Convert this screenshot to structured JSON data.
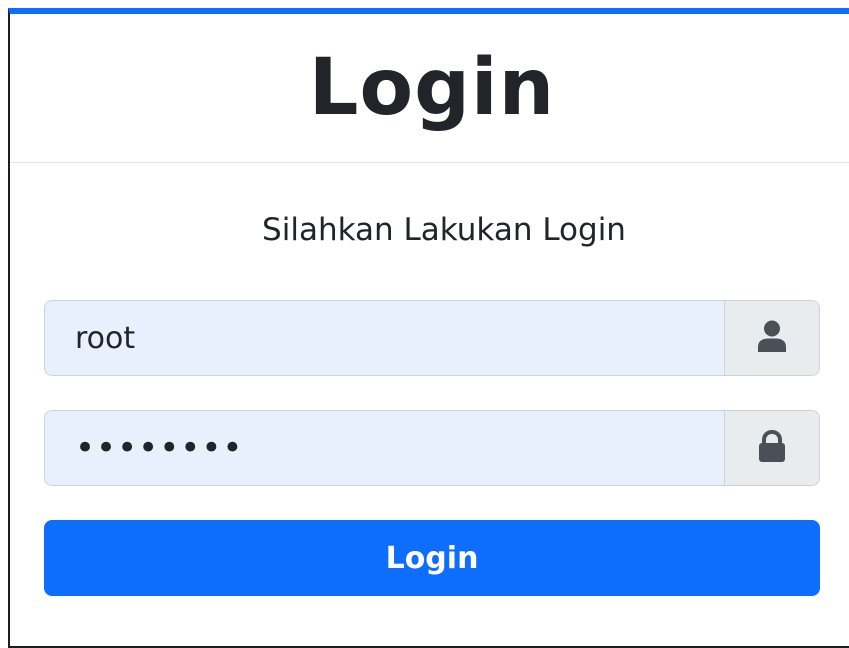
{
  "header": {
    "title": "Login"
  },
  "form": {
    "subtitle": "Silahkan Lakukan Login",
    "username": {
      "value": "root",
      "icon": "user-icon"
    },
    "password": {
      "value": "password",
      "icon": "lock-icon"
    },
    "submit_label": "Login"
  },
  "colors": {
    "accent": "#0d6efd",
    "autofill_bg": "#e8f0fe",
    "addon_bg": "#e9ecef"
  }
}
